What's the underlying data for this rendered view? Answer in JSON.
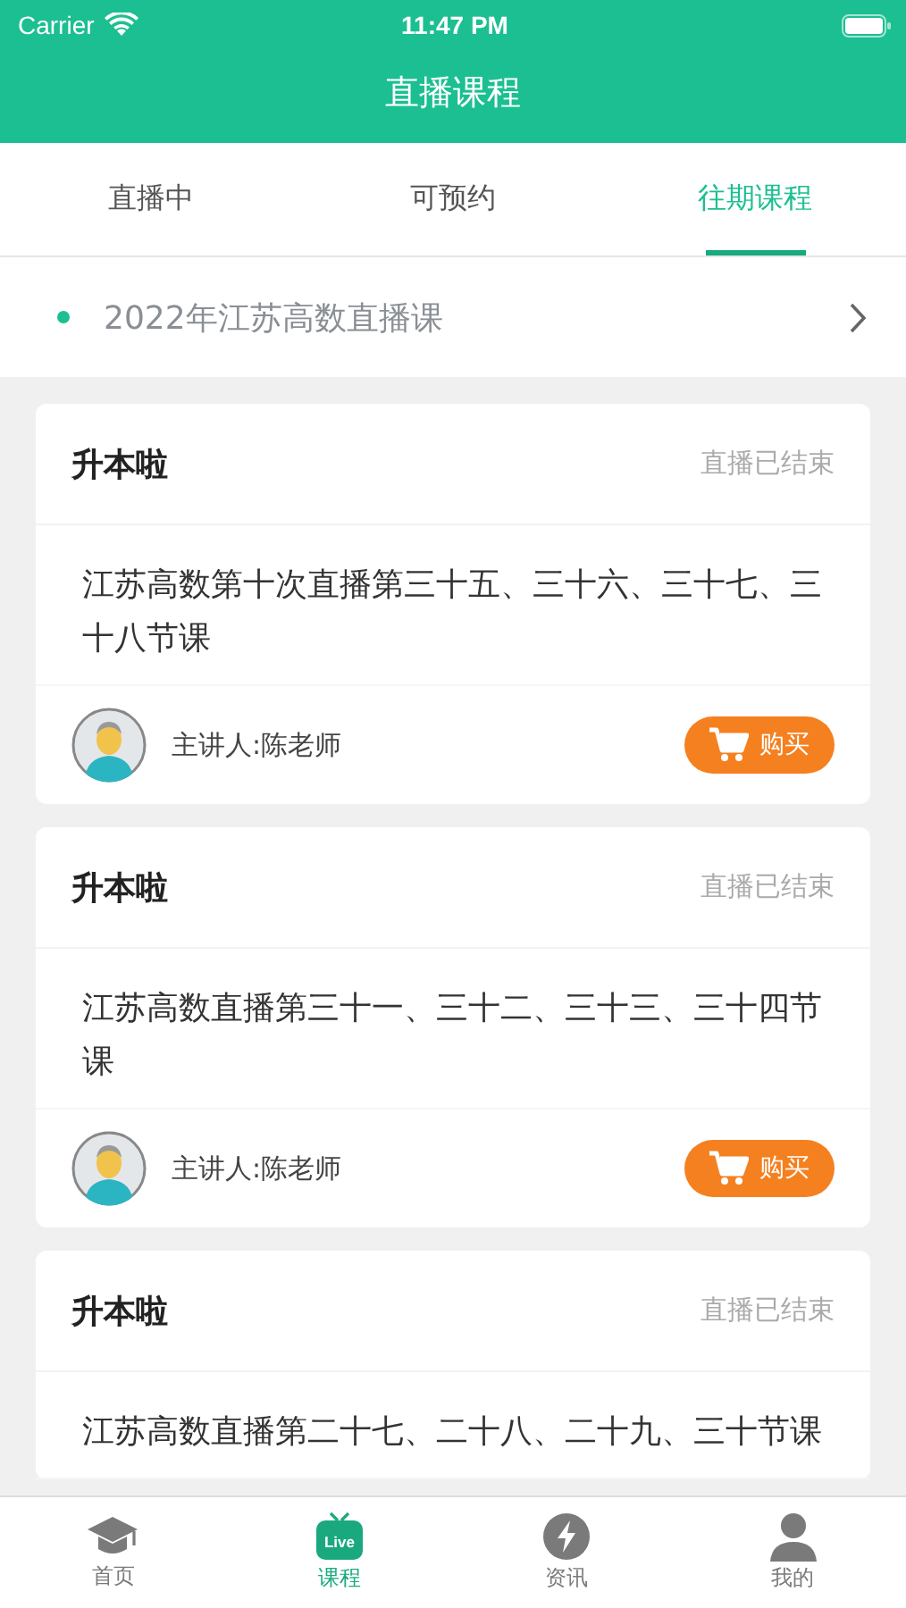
{
  "status_bar": {
    "carrier": "Carrier",
    "time": "11:47 PM"
  },
  "nav_title": "直播课程",
  "tabs": [
    {
      "label": "直播中",
      "selected": false
    },
    {
      "label": "可预约",
      "selected": false
    },
    {
      "label": "往期课程",
      "selected": true
    }
  ],
  "series_header": {
    "title": "2022年江苏高数直播课"
  },
  "cards": [
    {
      "title": "升本啦",
      "status": "直播已结束",
      "description": "江苏高数第十次直播第三十五、三十六、三十七、三十八节课",
      "speaker": "主讲人:陈老师",
      "button": "购买"
    },
    {
      "title": "升本啦",
      "status": "直播已结束",
      "description": "江苏高数直播第三十一、三十二、三十三、三十四节课",
      "speaker": "主讲人:陈老师",
      "button": "购买"
    },
    {
      "title": "升本啦",
      "status": "直播已结束",
      "description": "江苏高数直播第二十七、二十八、二十九、三十节课"
    }
  ],
  "bottom_tabs": [
    {
      "kind": "cap",
      "label": "首页",
      "selected": false
    },
    {
      "kind": "live",
      "label": "课程",
      "selected": true,
      "icon_text": "Live"
    },
    {
      "kind": "bolt",
      "label": "资讯",
      "selected": false
    },
    {
      "kind": "person",
      "label": "我的",
      "selected": false
    }
  ]
}
